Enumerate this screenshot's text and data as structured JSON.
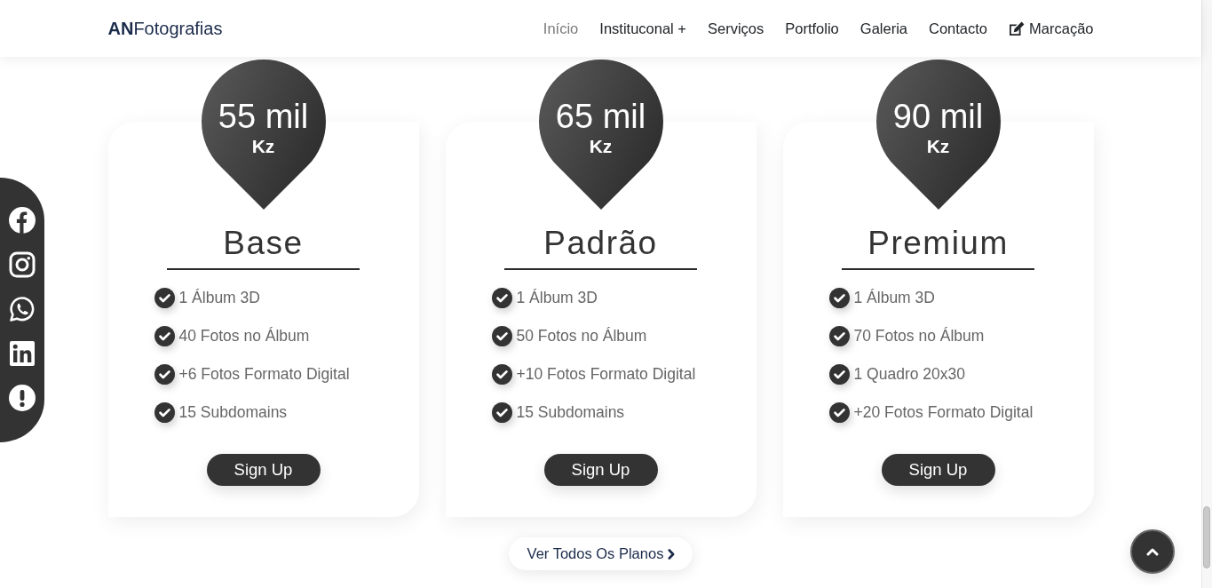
{
  "header": {
    "logo": "**AN**Fotografias",
    "nav": [
      {
        "label": "Início",
        "selected": true,
        "kind": "text"
      },
      {
        "label": "Instituconal +",
        "selected": false,
        "kind": "text"
      },
      {
        "label": "Serviços",
        "selected": false,
        "kind": "text"
      },
      {
        "label": "Portfolio",
        "selected": false,
        "kind": "text"
      },
      {
        "label": "Galeria",
        "selected": false,
        "kind": "text"
      },
      {
        "label": "Contacto",
        "selected": false,
        "kind": "text"
      },
      {
        "label": "Marcação",
        "selected": false,
        "kind": "icon"
      }
    ]
  },
  "plans": [
    {
      "price": "55 mil",
      "currency": "Kz",
      "name": "Base",
      "features": [
        "1 Álbum 3D",
        "40 Fotos no Álbum",
        "+6 Fotos Formato Digital",
        "15 Subdomains"
      ],
      "button": "Sign Up"
    },
    {
      "price": "65 mil",
      "currency": "Kz",
      "name": "Padrão",
      "features": [
        "1 Álbum 3D",
        "50 Fotos no Álbum",
        "+10 Fotos Formato Digital",
        "15 Subdomains"
      ],
      "button": "Sign Up"
    },
    {
      "price": "90 mil",
      "currency": "Kz",
      "name": "Premium",
      "features": [
        "1 Álbum 3D",
        "70 Fotos no Álbum",
        "1 Quadro 20x30",
        "+20 Fotos Formato Digital"
      ],
      "button": "Sign Up"
    }
  ],
  "all_plans_button": {
    "label": "Ver Todos Os Planos"
  }
}
